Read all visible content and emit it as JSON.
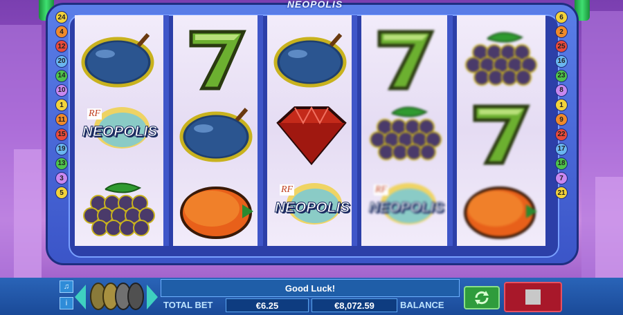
{
  "game": {
    "top_title": "NEOPOLIS",
    "logo_small": "RF",
    "logo_main": "NEOPOLIS"
  },
  "reels": [
    {
      "symbols": [
        "plum",
        "logo",
        "grapes"
      ]
    },
    {
      "symbols": [
        "seven",
        "plum",
        "orange"
      ]
    },
    {
      "symbols": [
        "plum",
        "diamond",
        "logo"
      ]
    },
    {
      "symbols": [
        "seven",
        "grapes",
        "logo"
      ],
      "spinning": true
    },
    {
      "symbols": [
        "grapes",
        "seven",
        "orange"
      ],
      "spinning": true
    }
  ],
  "paylines": {
    "left": [
      "24",
      "4",
      "12",
      "20",
      "14",
      "10",
      "1",
      "11",
      "15",
      "19",
      "13",
      "3",
      "5"
    ],
    "right": [
      "6",
      "2",
      "25",
      "16",
      "23",
      "8",
      "1",
      "9",
      "22",
      "17",
      "18",
      "7",
      "21"
    ]
  },
  "controls": {
    "message": "Good Luck!",
    "total_bet_label": "TOTAL BET",
    "total_bet_value": "€6.25",
    "balance_value": "€8,072.59",
    "balance_label": "BALANCE",
    "sound_icon": "music-note-icon",
    "info_icon": "info-icon",
    "auto_icon": "autoplay-icon",
    "stop_icon": "stop-icon"
  },
  "colors": {
    "frame": "#4b6bdf",
    "bar": "#1f5ea8",
    "spin_button": "#a8182a",
    "auto_button": "#2f9c3c"
  }
}
